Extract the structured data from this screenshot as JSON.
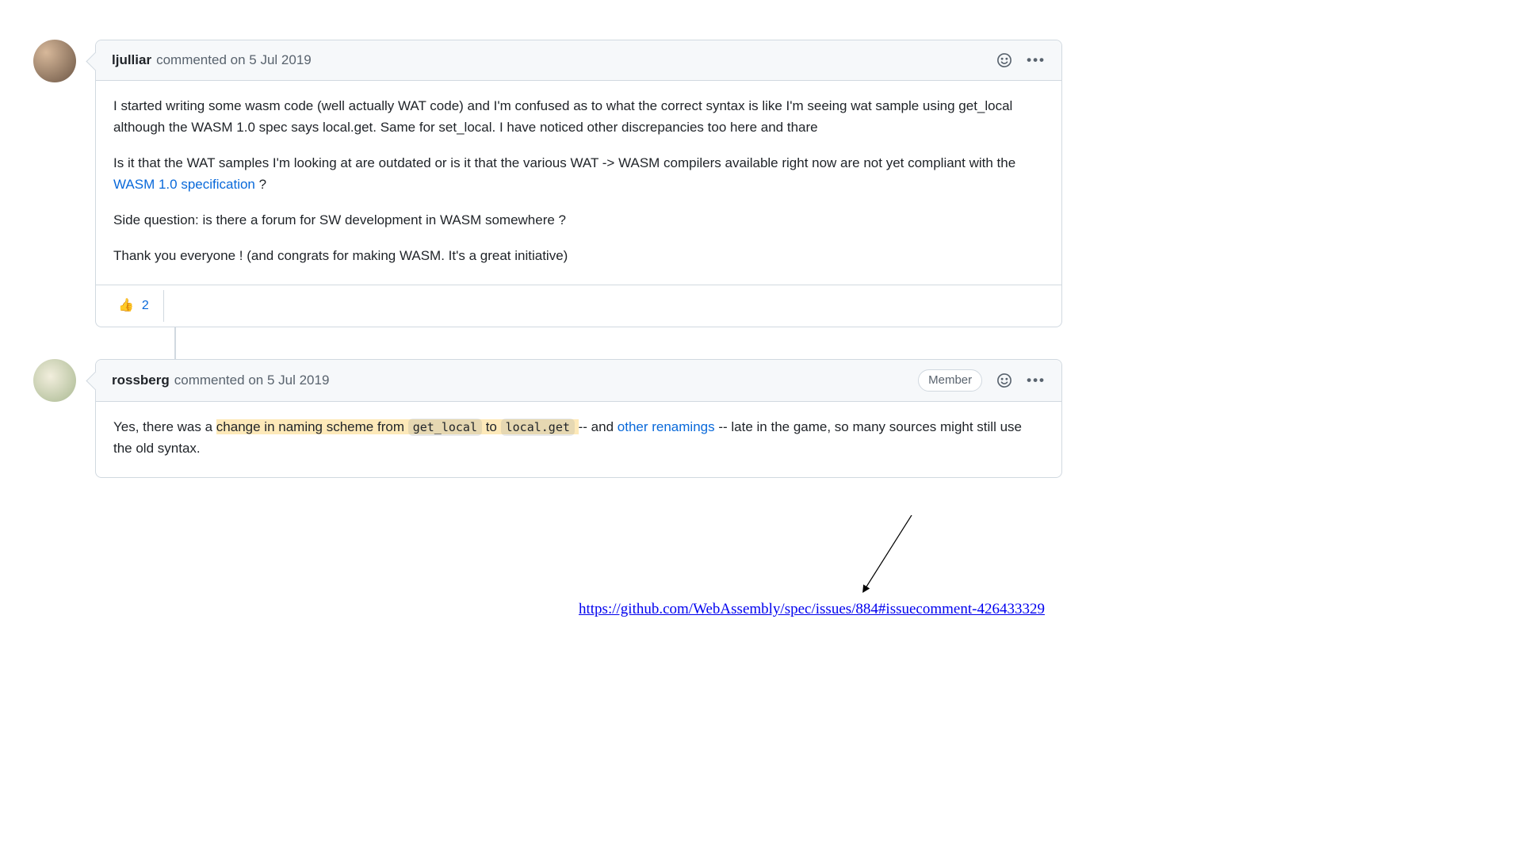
{
  "comments": [
    {
      "author": "ljulliar",
      "action": "commented",
      "date": "on 5 Jul 2019",
      "body": {
        "p1": "I started writing some wasm code (well actually WAT code) and I'm confused as to what the correct syntax is like I'm seeing wat sample using get_local although the WASM 1.0 spec says local.get. Same for set_local. I have noticed other discrepancies too here and thare",
        "p2_pre": "Is it that the WAT samples I'm looking at are outdated or is it that the various WAT -> WASM compilers available right now are not yet compliant with the ",
        "p2_link": "WASM 1.0 specification",
        "p2_post": " ?",
        "p3": "Side question: is there a forum for SW development in WASM somewhere ?",
        "p4": "Thank you everyone ! (and congrats for making WASM. It's a great initiative)"
      },
      "reaction": {
        "emoji": "👍",
        "count": "2"
      }
    },
    {
      "author": "rossberg",
      "action": "commented",
      "date": "on 5 Jul 2019",
      "badge": "Member",
      "body": {
        "p1_pre": "Yes, there was a ",
        "p1_hl_a": "change in naming scheme from ",
        "p1_code1": "get_local",
        "p1_hl_b": " to ",
        "p1_code2": "local.get",
        "p1_hl_c": " ",
        "p1_mid": "-- and ",
        "p1_link": "other renamings",
        "p1_post": " -- late in the game, so many sources might still use the old syntax."
      }
    }
  ],
  "annotation_url": "https://github.com/WebAssembly/spec/issues/884#issuecomment-426433329",
  "icons": {
    "face": "smiley-icon",
    "kebab": "kebab-icon"
  }
}
